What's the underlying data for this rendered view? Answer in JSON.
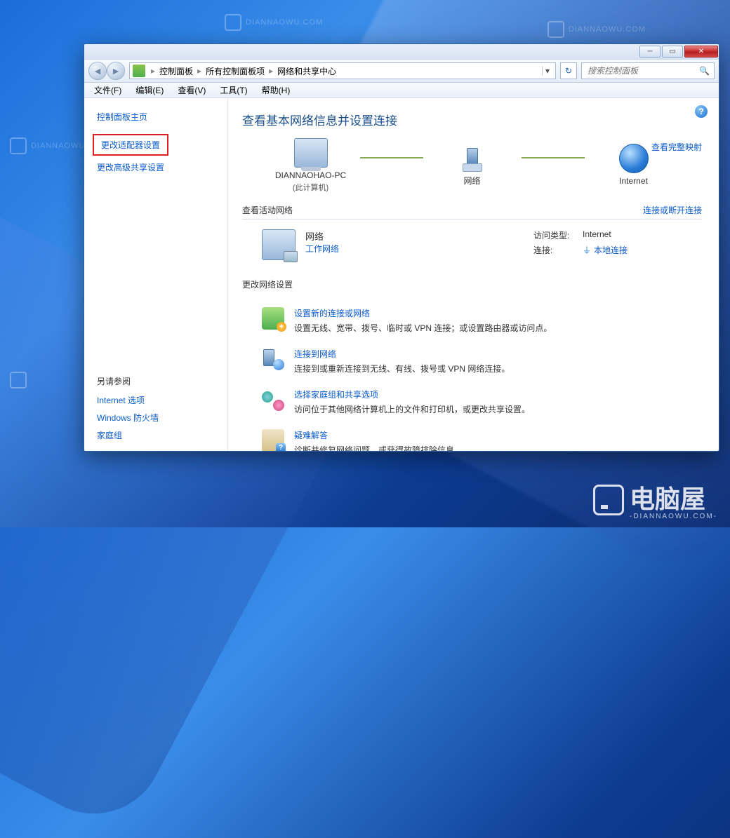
{
  "watermark": {
    "url": "DIANNAOWU.COM",
    "brand": "电脑屋"
  },
  "breadcrumb": {
    "root": "控制面板",
    "level1": "所有控制面板项",
    "current": "网络和共享中心"
  },
  "search": {
    "placeholder": "搜索控制面板"
  },
  "menu": {
    "file": "文件(F)",
    "edit": "编辑(E)",
    "view": "查看(V)",
    "tools": "工具(T)",
    "help": "帮助(H)"
  },
  "sidebar": {
    "home": "控制面板主页",
    "adapter": "更改适配器设置",
    "advanced": "更改高级共享设置",
    "see_also_title": "另请参阅",
    "see_also": {
      "internet": "Internet 选项",
      "firewall": "Windows 防火墙",
      "homegroup": "家庭组"
    }
  },
  "content": {
    "title": "查看基本网络信息并设置连接",
    "full_map": "查看完整映射",
    "nodes": {
      "computer": "DIANNAOHAO-PC",
      "computer_sub": "(此计算机)",
      "network": "网络",
      "internet": "Internet"
    },
    "active_header": "查看活动网络",
    "active_link": "连接或断开连接",
    "active": {
      "name": "网络",
      "type": "工作网络",
      "access_label": "访问类型:",
      "access_value": "Internet",
      "conn_label": "连接:",
      "conn_value": "本地连接"
    },
    "change_header": "更改网络设置",
    "tasks": {
      "new_title": "设置新的连接或网络",
      "new_desc": "设置无线、宽带、拨号、临时或 VPN 连接；或设置路由器或访问点。",
      "conn_title": "连接到网络",
      "conn_desc": "连接到或重新连接到无线、有线、拨号或 VPN 网络连接。",
      "home_title": "选择家庭组和共享选项",
      "home_desc": "访问位于其他网络计算机上的文件和打印机，或更改共享设置。",
      "diag_title": "疑难解答",
      "diag_desc": "诊断并修复网络问题，或获得故障排除信息。"
    }
  }
}
